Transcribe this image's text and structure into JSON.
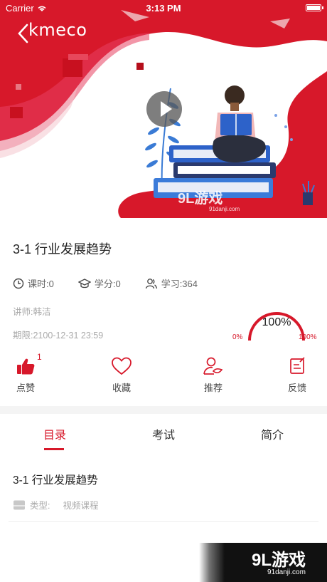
{
  "status_bar": {
    "carrier": "Carrier",
    "time": "3:13 PM"
  },
  "hero": {
    "logo_text": "kmeco",
    "watermark_text": "9L游戏",
    "watermark_url": "91danji.com"
  },
  "course": {
    "title": "3-1 行业发展趋势",
    "class_hours": "课时:0",
    "credits": "学分:0",
    "learners": "学习:364",
    "lecturer": "讲师:韩洁",
    "deadline": "期限:2100-12-31 23:59",
    "progress_label": "100%",
    "progress_fraction": 1.0,
    "progress_min": "0%",
    "progress_max": "100%"
  },
  "actions": {
    "like_label": "点赞",
    "like_count": "1",
    "favorite_label": "收藏",
    "recommend_label": "推荐",
    "feedback_label": "反馈"
  },
  "tabs": [
    {
      "label": "目录",
      "active": true
    },
    {
      "label": "考试",
      "active": false
    },
    {
      "label": "简介",
      "active": false
    }
  ],
  "lessons": [
    {
      "title": "3-1 行业发展趋势",
      "type_key": "类型:",
      "type_value": "视频课程"
    }
  ],
  "corner_watermark": {
    "text": "9L游戏",
    "url": "91danji.com"
  },
  "colors": {
    "accent": "#d7182a",
    "text": "#333333",
    "muted": "#aaaaaa"
  }
}
